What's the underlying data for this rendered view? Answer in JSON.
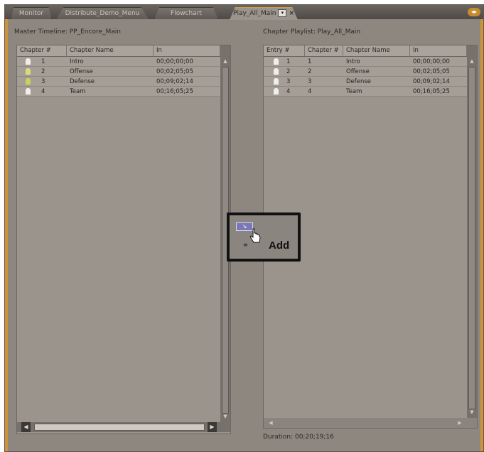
{
  "tabs": [
    {
      "label": "Monitor"
    },
    {
      "label": "Distribute_Demo_Menu"
    },
    {
      "label": "Flowchart"
    },
    {
      "label": "Play_All_Main",
      "active": true,
      "menu_glyph": "▾",
      "close_glyph": "×"
    }
  ],
  "panel_menu_icon": "panel-menu-icon",
  "master": {
    "title": "Master Timeline: PP_Encore_Main",
    "columns": [
      "Chapter #",
      "Chapter Name",
      "In"
    ],
    "rows": [
      {
        "num": "1",
        "name": "Intro",
        "in": "00;00;00;00",
        "marker_color": "#f1eee9"
      },
      {
        "num": "2",
        "name": "Offense",
        "in": "00;02;05;05",
        "marker_color": "#d9dc7a"
      },
      {
        "num": "3",
        "name": "Defense",
        "in": "00;09;02;14",
        "marker_color": "#c9d35a"
      },
      {
        "num": "4",
        "name": "Team",
        "in": "00;16;05;25",
        "marker_color": "#f1eee9"
      }
    ]
  },
  "playlist": {
    "title": "Chapter Playlist: Play_All_Main",
    "columns": [
      "Entry #",
      "Chapter #",
      "Chapter Name",
      "In"
    ],
    "rows": [
      {
        "entry": "1",
        "chapter": "1",
        "name": "Intro",
        "in": "00;00;00;00"
      },
      {
        "entry": "2",
        "chapter": "2",
        "name": "Offense",
        "in": "00;02;05;05"
      },
      {
        "entry": "3",
        "chapter": "3",
        "name": "Defense",
        "in": "00;09;02;14"
      },
      {
        "entry": "4",
        "chapter": "4",
        "name": "Team",
        "in": "00;16;05;25"
      }
    ],
    "duration": "Duration: 00;20;19;16"
  },
  "callout": {
    "label": "Add"
  },
  "colors": {
    "accent": "#d09436",
    "add_button": "#7b78b8"
  }
}
